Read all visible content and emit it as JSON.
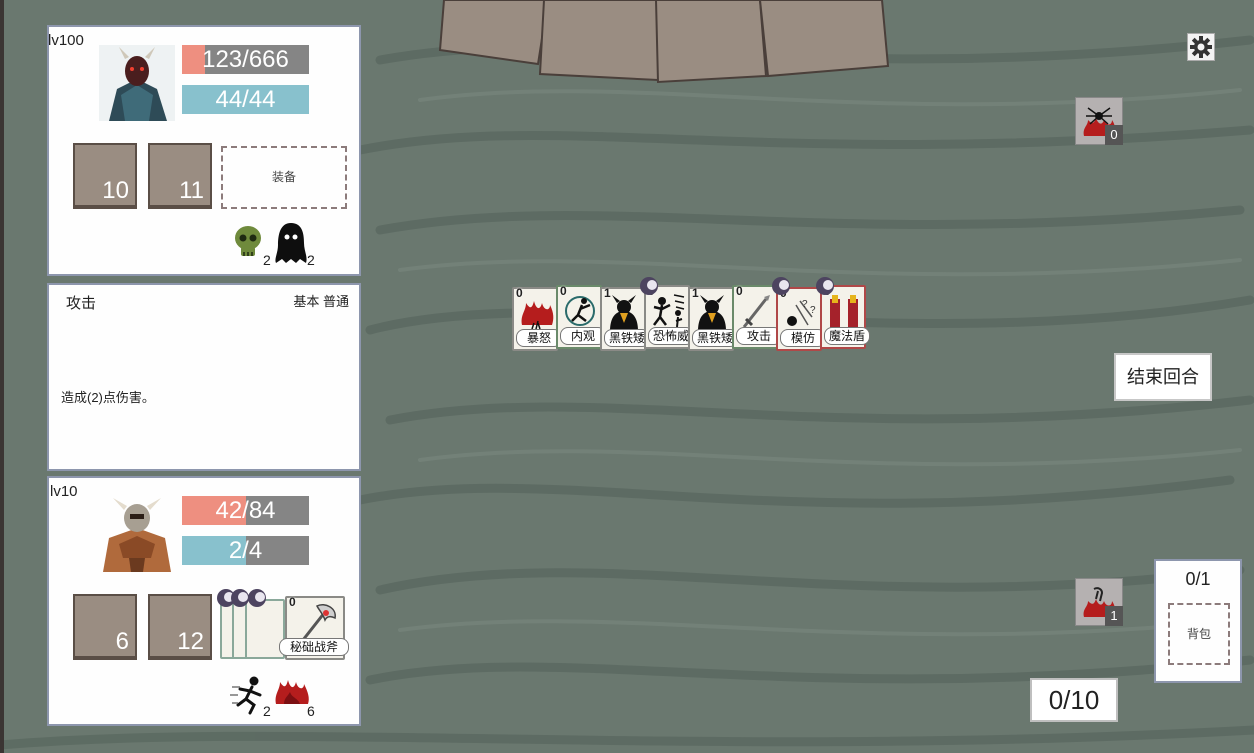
{
  "player": {
    "level": "lv100",
    "hp": "123/666",
    "hp_fraction": 0.185,
    "mp": "44/44",
    "mp_fraction": 1.0,
    "slot1": "10",
    "slot2": "11",
    "equip_label": "装备",
    "status": [
      {
        "icon": "skull-icon",
        "count": "2"
      },
      {
        "icon": "ghost-icon",
        "count": "2"
      }
    ]
  },
  "card_detail": {
    "name": "攻击",
    "tags": "基本 普通",
    "description": "造成(2)点伤害。"
  },
  "enemy": {
    "level": "lv10",
    "hp": "42/84",
    "hp_fraction": 0.5,
    "mp": "2/4",
    "mp_fraction": 0.5,
    "slot1": "6",
    "slot2": "12",
    "intent_card": "秘础战斧",
    "intent_cost": "0",
    "status": [
      {
        "icon": "running-figure-icon",
        "count": "2"
      },
      {
        "icon": "fire-icon",
        "count": "6"
      }
    ]
  },
  "hand": [
    {
      "name": "暴怒",
      "cost": "0",
      "art": "fire"
    },
    {
      "name": "内观",
      "cost": "0",
      "art": "meditate"
    },
    {
      "name": "黑铁矮",
      "cost": "1",
      "art": "dwarf"
    },
    {
      "name": "恐怖威",
      "cost": "0",
      "art": "fear"
    },
    {
      "name": "黑铁矮",
      "cost": "1",
      "art": "dwarf"
    },
    {
      "name": "攻击",
      "cost": "0",
      "art": "sword"
    },
    {
      "name": "模仿",
      "cost": "0",
      "art": "mimic"
    },
    {
      "name": "魔法盾",
      "cost": "0",
      "art": "shield"
    }
  ],
  "piles": {
    "top_count": "0",
    "bottom_count": "1"
  },
  "buttons": {
    "end_turn": "结束回合"
  },
  "backpack": {
    "count": "0/1",
    "label": "背包"
  },
  "energy": "0/10",
  "colors": {
    "hp_bar": "#ee8f80",
    "mp_bar": "#88c1cd",
    "table": "#6a786f"
  }
}
